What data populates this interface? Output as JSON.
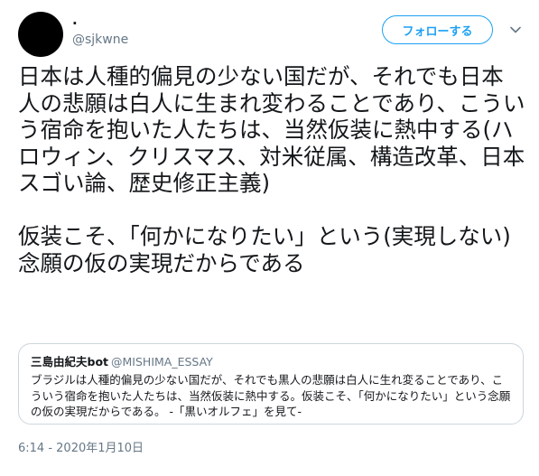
{
  "user": {
    "display_name": ".",
    "handle": "@sjkwne"
  },
  "header": {
    "follow_label": "フォローする",
    "more_icon": "chevron-down-icon"
  },
  "tweet": {
    "text": "日本は人種的偏見の少ない国だが、それでも日本人の悲願は白人に生まれ変わることであり、こういう宿命を抱いた人たちは、当然仮装に熱中する(ハロウィン、クリスマス、対米従属、構造改革、日本スゴい論、歴史修正主義)\n\n仮装こそ、「何かになりたい」という(実現しない)念願の仮の実現だからである"
  },
  "quote": {
    "name": "三島由紀夫bot",
    "handle": "@MISHIMA_ESSAY",
    "text": "ブラジルは人種的偏見の少ない国だが、それでも黒人の悲願は白人に生れ変ることであり、こういう宿命を抱いた人たちは、当然仮装に熱中する。仮装こそ、「何かになりたい」という念願の仮の実現だからである。 -「黒いオルフェ」を見て-"
  },
  "timestamp": "6:14 - 2020年1月10日",
  "colors": {
    "accent": "#1da1f2",
    "secondary_text": "#657786",
    "border": "#ccd6dd"
  }
}
